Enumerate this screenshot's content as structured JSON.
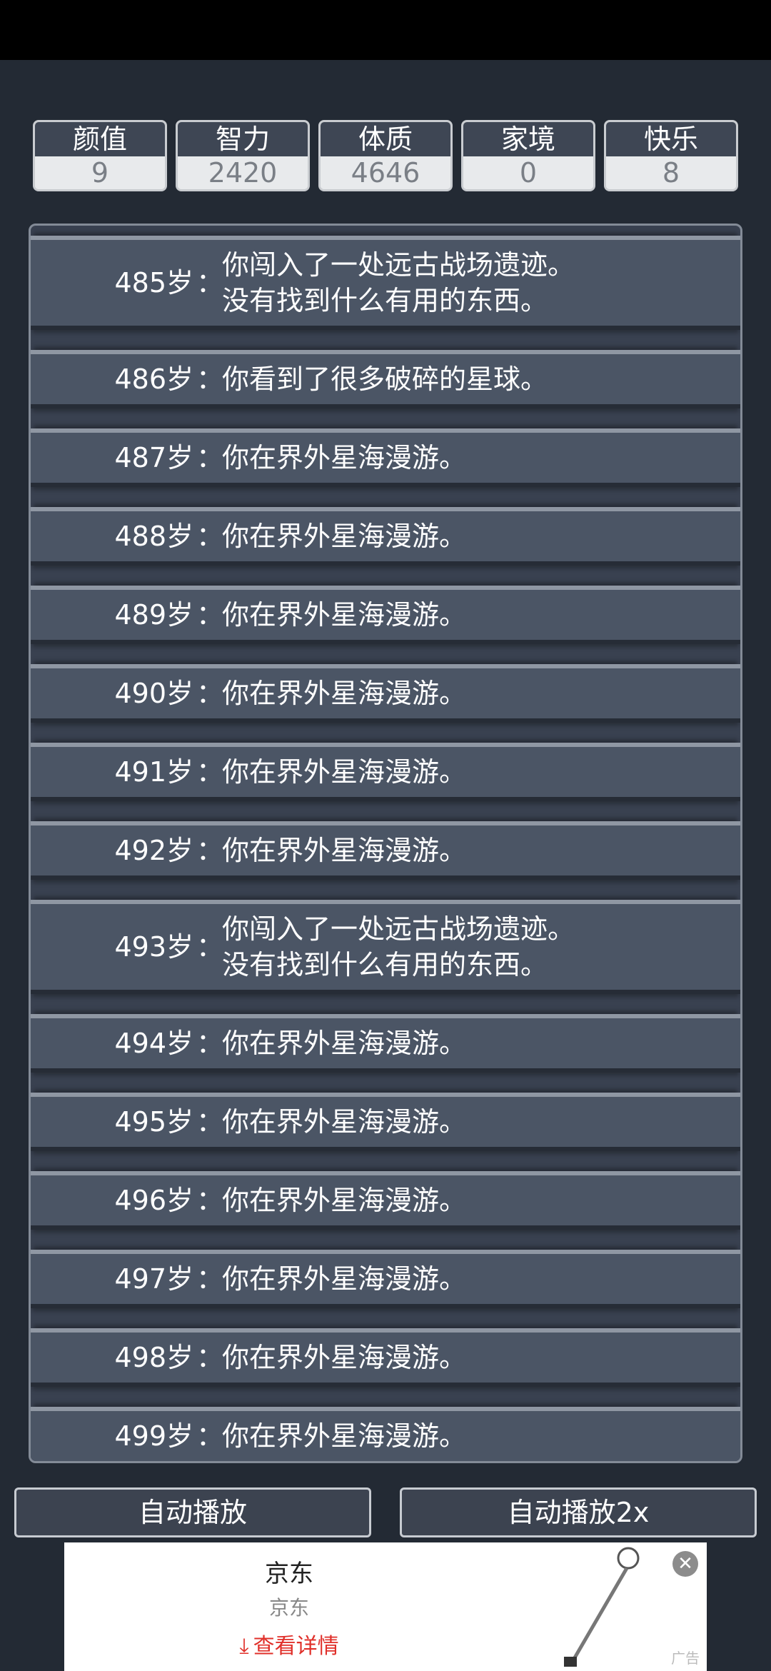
{
  "stats": [
    {
      "label": "颜值",
      "value": "9"
    },
    {
      "label": "智力",
      "value": "2420"
    },
    {
      "label": "体质",
      "value": "4646"
    },
    {
      "label": "家境",
      "value": "0"
    },
    {
      "label": "快乐",
      "value": "8"
    }
  ],
  "log": [
    {
      "age": "485岁",
      "text": "你闯入了一处远古战场遗迹。\n没有找到什么有用的东西。"
    },
    {
      "age": "486岁",
      "text": "你看到了很多破碎的星球。"
    },
    {
      "age": "487岁",
      "text": "你在界外星海漫游。"
    },
    {
      "age": "488岁",
      "text": "你在界外星海漫游。"
    },
    {
      "age": "489岁",
      "text": "你在界外星海漫游。"
    },
    {
      "age": "490岁",
      "text": "你在界外星海漫游。"
    },
    {
      "age": "491岁",
      "text": "你在界外星海漫游。"
    },
    {
      "age": "492岁",
      "text": "你在界外星海漫游。"
    },
    {
      "age": "493岁",
      "text": "你闯入了一处远古战场遗迹。\n没有找到什么有用的东西。"
    },
    {
      "age": "494岁",
      "text": "你在界外星海漫游。"
    },
    {
      "age": "495岁",
      "text": "你在界外星海漫游。"
    },
    {
      "age": "496岁",
      "text": "你在界外星海漫游。"
    },
    {
      "age": "497岁",
      "text": "你在界外星海漫游。"
    },
    {
      "age": "498岁",
      "text": "你在界外星海漫游。"
    },
    {
      "age": "499岁",
      "text": "你在界外星海漫游。"
    }
  ],
  "colon": "：",
  "buttons": {
    "autoplay": "自动播放",
    "autoplay2x": "自动播放2x"
  },
  "ad": {
    "title": "京东",
    "subtitle": "京东",
    "cta": "查看详情",
    "cta_icon": "download-arrow-icon",
    "close_icon": "close-icon",
    "tag": "广告"
  }
}
